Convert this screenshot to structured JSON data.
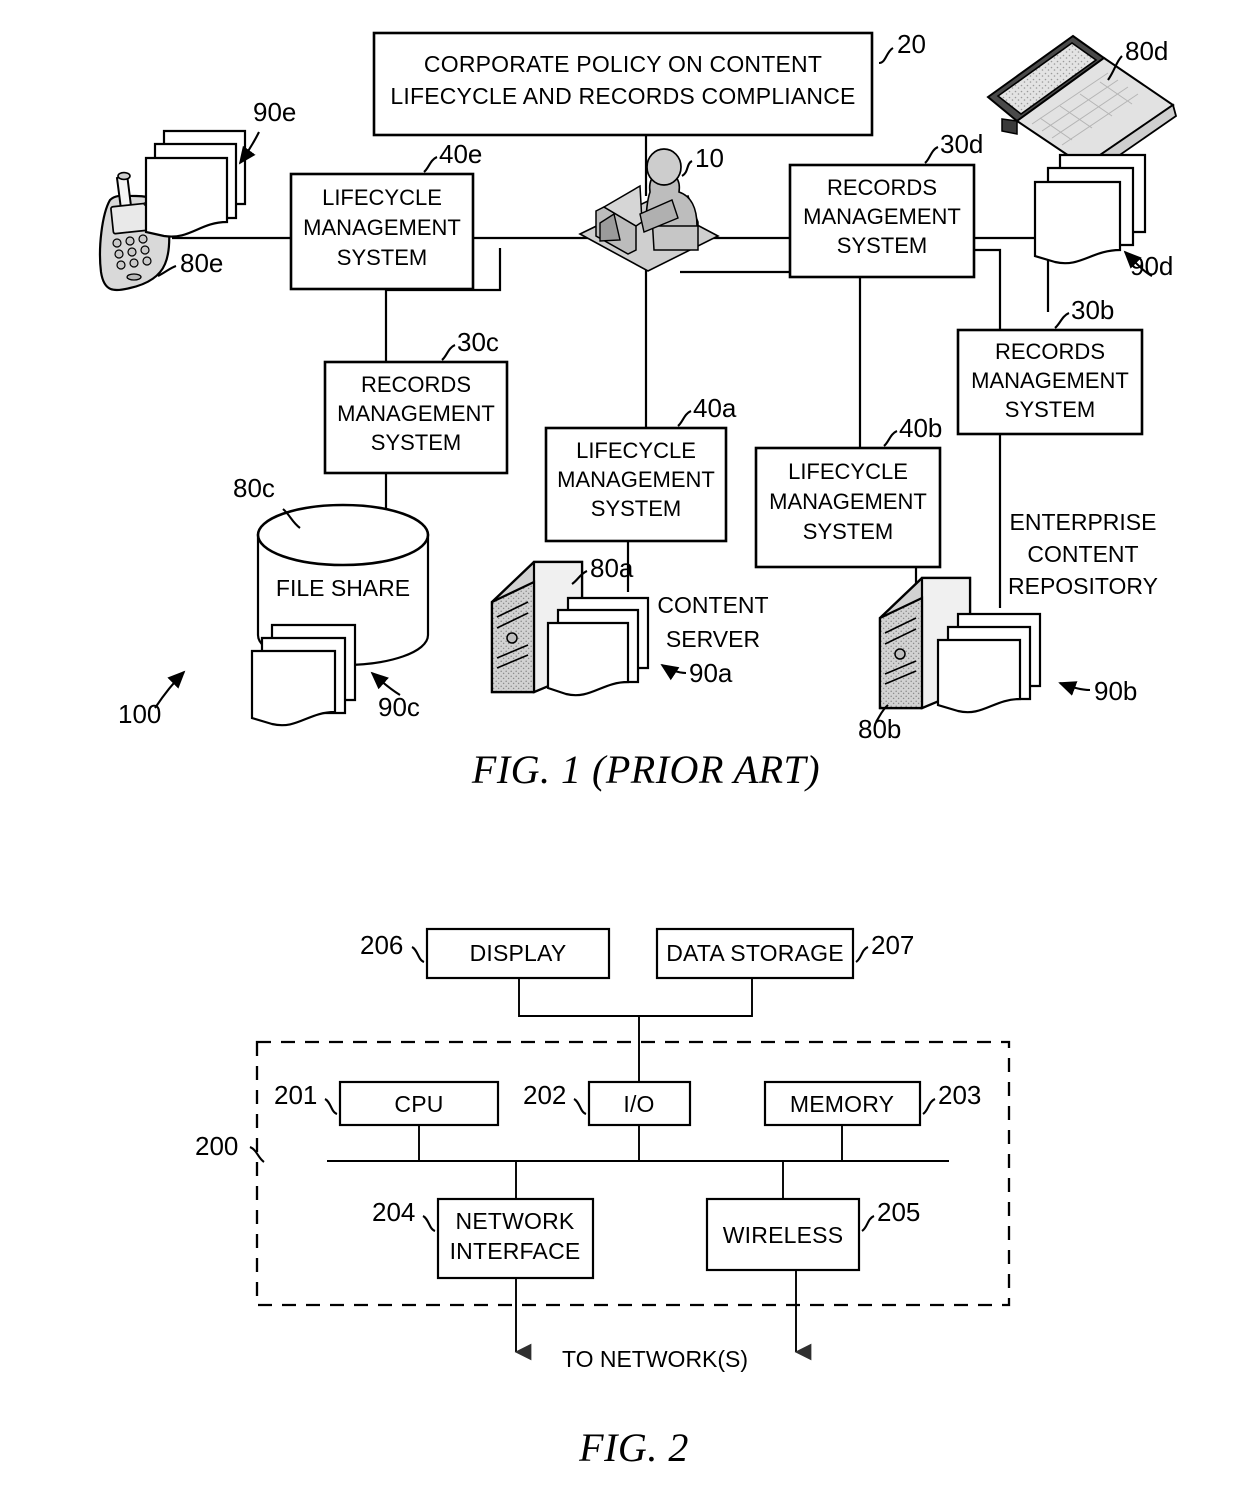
{
  "figures": [
    {
      "id": "fig1",
      "caption": "FIG. 1 (PRIOR ART)",
      "system_ref": "100",
      "policy_box": {
        "ref": "20",
        "line1": "CORPORATE POLICY ON CONTENT",
        "line2": "LIFECYCLE AND RECORDS COMPLIANCE"
      },
      "user": {
        "ref": "10",
        "icon": "user-at-workstation-icon"
      },
      "boxes": [
        {
          "ref": "40e",
          "line1": "LIFECYCLE",
          "line2": "MANAGEMENT",
          "line3": "SYSTEM"
        },
        {
          "ref": "30d",
          "line1": "RECORDS",
          "line2": "MANAGEMENT",
          "line3": "SYSTEM"
        },
        {
          "ref": "30c",
          "line1": "RECORDS",
          "line2": "MANAGEMENT",
          "line3": "SYSTEM"
        },
        {
          "ref": "40a",
          "line1": "LIFECYCLE",
          "line2": "MANAGEMENT",
          "line3": "SYSTEM"
        },
        {
          "ref": "40b",
          "line1": "LIFECYCLE",
          "line2": "MANAGEMENT",
          "line3": "SYSTEM"
        },
        {
          "ref": "30b",
          "line1": "RECORDS",
          "line2": "MANAGEMENT",
          "line3": "SYSTEM"
        }
      ],
      "devices": [
        {
          "ref": "80e",
          "icon": "mobile-phone-icon",
          "docs_ref": "90e",
          "label": ""
        },
        {
          "ref": "80d",
          "icon": "laptop-icon",
          "docs_ref": "90d",
          "label": ""
        },
        {
          "ref": "80c",
          "icon": "database-cylinder-icon",
          "docs_ref": "90c",
          "label": "FILE SHARE"
        },
        {
          "ref": "80a",
          "icon": "server-tower-icon",
          "docs_ref": "90a",
          "label_line1": "CONTENT",
          "label_line2": "SERVER"
        },
        {
          "ref": "80b",
          "icon": "server-tower-icon",
          "docs_ref": "90b",
          "label_line1": "ENTERPRISE",
          "label_line2": "CONTENT",
          "label_line3": "REPOSITORY"
        }
      ]
    },
    {
      "id": "fig2",
      "caption": "FIG. 2",
      "system_ref": "200",
      "boxes": [
        {
          "ref": "206",
          "label": "DISPLAY"
        },
        {
          "ref": "207",
          "label": "DATA STORAGE"
        },
        {
          "ref": "201",
          "label": "CPU"
        },
        {
          "ref": "202",
          "label": "I/O"
        },
        {
          "ref": "203",
          "label": "MEMORY"
        },
        {
          "ref": "204",
          "line1": "NETWORK",
          "line2": "INTERFACE"
        },
        {
          "ref": "205",
          "label": "WIRELESS"
        }
      ],
      "network_label": "TO NETWORK(S)"
    }
  ]
}
